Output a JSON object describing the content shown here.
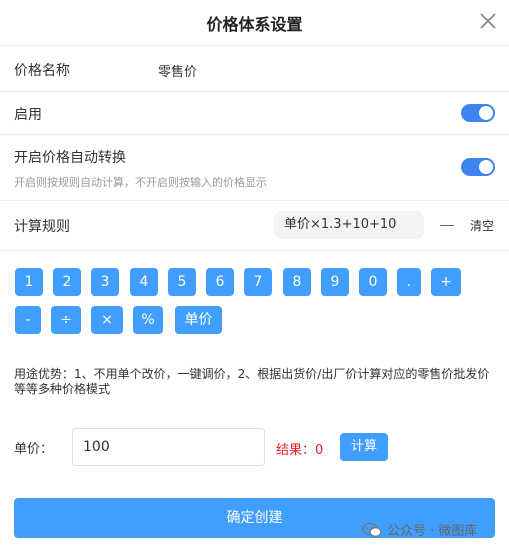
{
  "dialog": {
    "title": "价格体系设置"
  },
  "price_name": {
    "label": "价格名称",
    "value": "零售价"
  },
  "enable": {
    "label": "启用",
    "on": true
  },
  "auto_convert": {
    "label": "开启价格自动转换",
    "hint": "开启则按规则自动计算，不开启则按输入的价格显示",
    "on": true
  },
  "rule": {
    "label": "计算规则",
    "formula": "单价×1.3+10+10",
    "clear_label": "清空"
  },
  "keypad": {
    "row1": [
      "1",
      "2",
      "3",
      "4",
      "5",
      "6",
      "7",
      "8",
      "9",
      "0",
      ".",
      "+"
    ],
    "row2": [
      "-",
      "÷",
      "×",
      "%",
      "单价"
    ]
  },
  "note": "用途优势：1、不用单个改价，一键调价，2、根据出货价/出厂价计算对应的零售价批发价等等多种价格模式",
  "calc": {
    "price_label": "单价：",
    "price_value": "100",
    "result_text": "结果：0",
    "button_label": "计算"
  },
  "submit": {
    "label": "确定创建"
  },
  "watermark": {
    "text": "公众号 · 微图库"
  },
  "colors": {
    "accent": "#409eff",
    "toggle": "#3d84ee",
    "result": "#e02020"
  }
}
